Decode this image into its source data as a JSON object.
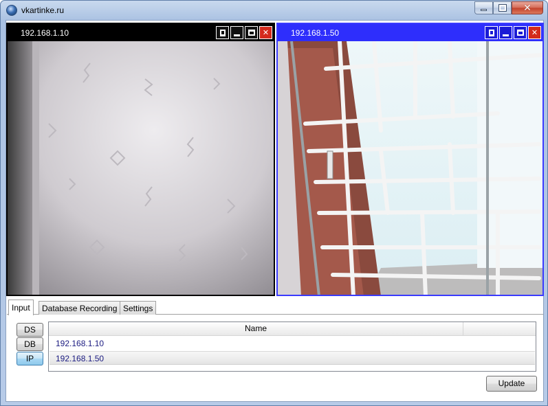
{
  "window": {
    "title": "vkartinke.ru"
  },
  "cameras": [
    {
      "title": "192.168.1.10",
      "state": "inactive"
    },
    {
      "title": "192.168.1.50",
      "state": "active"
    }
  ],
  "tabs": [
    {
      "label": "Input",
      "active": true
    },
    {
      "label": "Database Recording",
      "active": false
    },
    {
      "label": "Settings",
      "active": false
    }
  ],
  "source_buttons": [
    {
      "label": "DS",
      "active": false
    },
    {
      "label": "DB",
      "active": false
    },
    {
      "label": "IP",
      "active": true
    }
  ],
  "grid": {
    "columns": [
      "Name"
    ],
    "rows": [
      {
        "name": "192.168.1.10",
        "selected": false
      },
      {
        "name": "192.168.1.50",
        "selected": true
      }
    ]
  },
  "actions": {
    "update_label": "Update"
  },
  "colors": {
    "active_panel": "#2e2efc",
    "inactive_panel": "#000000",
    "close_button": "#d42a1c"
  }
}
